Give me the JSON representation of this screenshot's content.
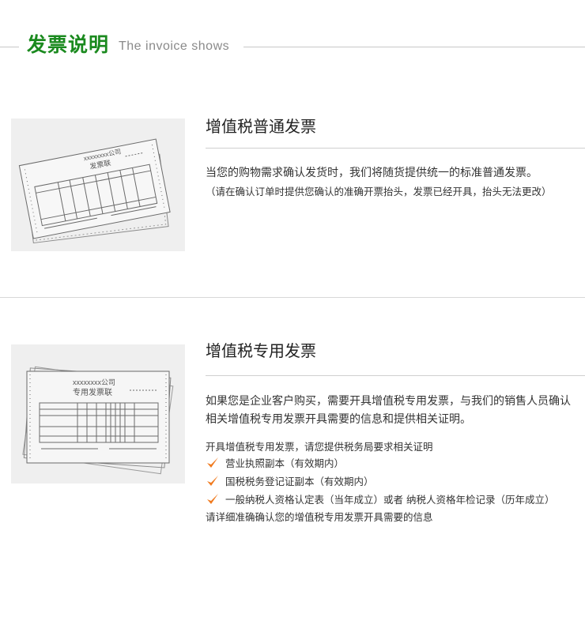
{
  "header": {
    "title": "发票说明",
    "subtitle": "The invoice shows"
  },
  "colors": {
    "brand_green": "#1b8a1f",
    "check_orange": "#f07a1e",
    "thumb_bg": "#efefef"
  },
  "section_general": {
    "title": "增值税普通发票",
    "description": "当您的购物需求确认发货时，我们将随货提供统一的标准普通发票。",
    "note": "（请在确认订单时提供您确认的准确开票抬头，发票已经开具，抬头无法更改）",
    "image": {
      "company_text": "xxxxxxxx公司",
      "form_text": "发票联",
      "icon": "invoice-sketch-icon"
    }
  },
  "section_special": {
    "title": "增值税专用发票",
    "description": "如果您是企业客户购买，需要开具增值税专用发票，与我们的销售人员确认相关增值税专用发票开具需要的信息和提供相关证明。",
    "list_intro": "开具增值税专用发票，请您提供税务局要求相关证明",
    "requirements": [
      "营业执照副本（有效期内）",
      "国税税务登记证副本（有效期内）",
      "一般纳税人资格认定表（当年成立）或者 纳税人资格年检记录（历年成立）"
    ],
    "list_outro": "请详细准确确认您的增值税专用发票开具需要的信息",
    "image": {
      "company_text": "xxxxxxxx公司",
      "form_text": "专用发票联",
      "icon": "special-invoice-sketch-icon"
    }
  }
}
